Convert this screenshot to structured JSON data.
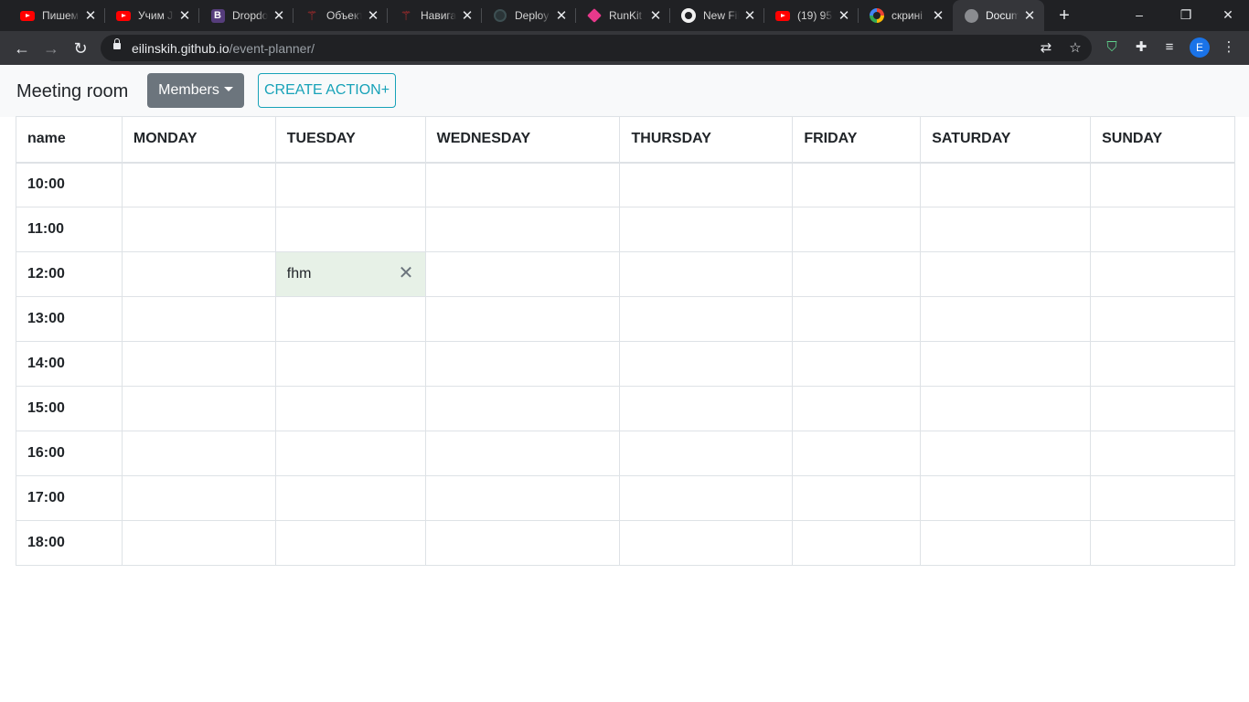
{
  "browser": {
    "tabs": [
      {
        "title": "Пишем",
        "icon": "youtube-icon"
      },
      {
        "title": "Учим Ja",
        "icon": "youtube-icon"
      },
      {
        "title": "Dropdo",
        "icon": "bootstrap-icon"
      },
      {
        "title": "Объект",
        "icon": "red-figure-icon"
      },
      {
        "title": "Навига",
        "icon": "red-figure-icon"
      },
      {
        "title": "Deploy",
        "icon": "deploy-icon"
      },
      {
        "title": "RunKit",
        "icon": "runkit-icon"
      },
      {
        "title": "New Fil",
        "icon": "github-icon"
      },
      {
        "title": "(19) 95",
        "icon": "youtube-icon"
      },
      {
        "title": "скрині",
        "icon": "google-icon"
      },
      {
        "title": "Docum",
        "icon": "globe-icon"
      }
    ],
    "url_host": "eilinskih.github.io",
    "url_path": "/event-planner/",
    "profile_initial": "E"
  },
  "page": {
    "brand": "Meeting room",
    "members_label": "Members",
    "create_label": "CREATE ACTION+",
    "table": {
      "headers": [
        "name",
        "MONDAY",
        "TUESDAY",
        "WEDNESDAY",
        "THURSDAY",
        "FRIDAY",
        "SATURDAY",
        "SUNDAY"
      ],
      "times": [
        "10:00",
        "11:00",
        "12:00",
        "13:00",
        "14:00",
        "15:00",
        "16:00",
        "17:00",
        "18:00"
      ],
      "events": [
        {
          "time": "12:00",
          "day": "TUESDAY",
          "title": "fhm"
        }
      ]
    }
  },
  "colors": {
    "event_bg": "#e7f1e7",
    "members_btn": "#6c757d",
    "create_btn": "#17a2b8"
  }
}
